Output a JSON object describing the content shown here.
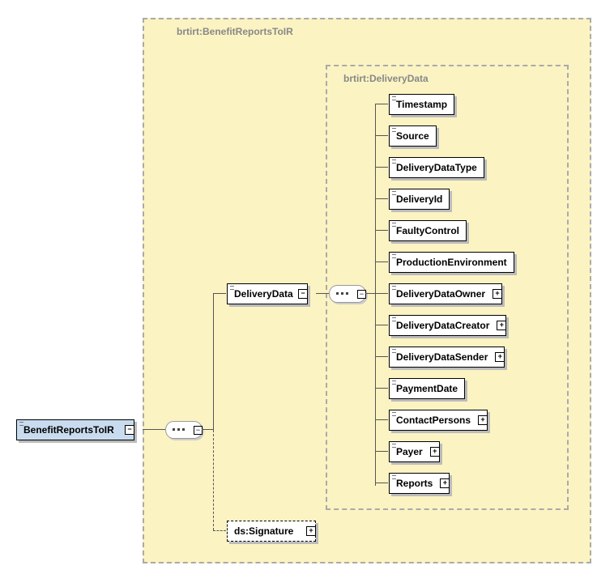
{
  "namespaces": {
    "outer": "brtirt:BenefitReportsToIR",
    "inner": "brtirt:DeliveryData"
  },
  "root": {
    "label": "BenefitReportsToIR"
  },
  "deliveryData": {
    "label": "DeliveryData"
  },
  "signature": {
    "label": "ds:Signature"
  },
  "children": [
    {
      "label": "Timestamp",
      "expandable": false
    },
    {
      "label": "Source",
      "expandable": false
    },
    {
      "label": "DeliveryDataType",
      "expandable": false
    },
    {
      "label": "DeliveryId",
      "expandable": false
    },
    {
      "label": "FaultyControl",
      "expandable": false
    },
    {
      "label": "ProductionEnvironment",
      "expandable": false
    },
    {
      "label": "DeliveryDataOwner",
      "expandable": true
    },
    {
      "label": "DeliveryDataCreator",
      "expandable": true
    },
    {
      "label": "DeliveryDataSender",
      "expandable": true
    },
    {
      "label": "PaymentDate",
      "expandable": false
    },
    {
      "label": "ContactPersons",
      "expandable": true
    },
    {
      "label": "Payer",
      "expandable": true
    },
    {
      "label": "Reports",
      "expandable": true
    }
  ],
  "glyphs": {
    "minus": "−",
    "plus": "+"
  }
}
